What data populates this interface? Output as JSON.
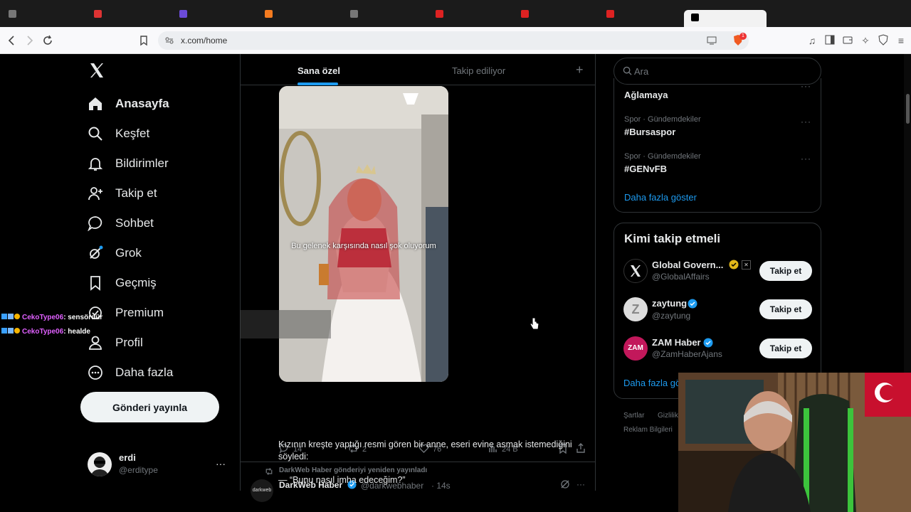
{
  "browser": {
    "url": "x.com/home",
    "tab_colors": [
      "#777",
      "#d33",
      "#6b4bd8",
      "#f47b20",
      "#777",
      "#d22",
      "#d22",
      "#d22"
    ],
    "shield_badge": "1"
  },
  "nav": {
    "items": [
      {
        "label": "Anasayfa",
        "icon": "home-icon"
      },
      {
        "label": "Keşfet",
        "icon": "search-icon"
      },
      {
        "label": "Bildirimler",
        "icon": "bell-icon"
      },
      {
        "label": "Takip et",
        "icon": "follow-icon"
      },
      {
        "label": "Sohbet",
        "icon": "chat-icon"
      },
      {
        "label": "Grok",
        "icon": "grok-icon"
      },
      {
        "label": "Geçmiş",
        "icon": "bookmark-icon"
      },
      {
        "label": "Premium",
        "icon": "premium-icon"
      },
      {
        "label": "Profil",
        "icon": "profile-icon"
      },
      {
        "label": "Daha fazla",
        "icon": "more-circle-icon"
      }
    ],
    "post_button": "Gönderi yayınla",
    "account": {
      "name": "erdi",
      "handle": "@erditype"
    }
  },
  "feed": {
    "tabs": [
      "Sana özel",
      "Takip ediliyor"
    ],
    "media_caption": "Bu gelenek karşısında nasıl şok oluyorum",
    "actions": {
      "replies": "14",
      "reposts": "2",
      "likes": "76",
      "views": "24 B"
    },
    "next_post": {
      "repost_note": "DarkWeb Haber gönderiyi yeniden yayınladı",
      "author": "DarkWeb Haber",
      "handle": "@darkwebhaber",
      "time": "· 14s",
      "text": "Kızının kreşte yaptığı resmi gören bir anne, eseri evine asmak istemediğini söyledi:",
      "quote": "— “Bunu nasıl imha edeceğim?”",
      "avatar_text": "darkweb"
    }
  },
  "sidebar": {
    "search_placeholder": "Ara",
    "trends": [
      {
        "meta": "",
        "name": "Ağlamaya"
      },
      {
        "meta": "Spor · Gündemdekiler",
        "name": "#Bursaspor"
      },
      {
        "meta": "Spor · Gündemdekiler",
        "name": "#GENvFB"
      }
    ],
    "show_more": "Daha fazla göster",
    "who_to_follow": {
      "title": "Kimi takip etmeli",
      "suggestions": [
        {
          "name": "Global Govern...",
          "handle": "@GlobalAffairs",
          "button": "Takip et"
        },
        {
          "name": "zaytung",
          "handle": "@zaytung",
          "button": "Takip et"
        },
        {
          "name": "ZAM Haber",
          "handle": "@ZamHaberAjans",
          "button": "Takip et"
        }
      ],
      "show_more": "Daha fazla gö"
    },
    "footer": {
      "terms": "Şartlar",
      "privacy": "Gizlilik",
      "ads": "Reklam Bilgileri"
    }
  },
  "overlay_chat": [
    {
      "user": "CekoType06",
      "message": ": sensördür"
    },
    {
      "user": "CekoType06",
      "message": ": healde"
    }
  ],
  "colors": {
    "accent": "#1d9bf0",
    "background": "#000000",
    "border": "#2f3336",
    "muted": "#71767b"
  }
}
